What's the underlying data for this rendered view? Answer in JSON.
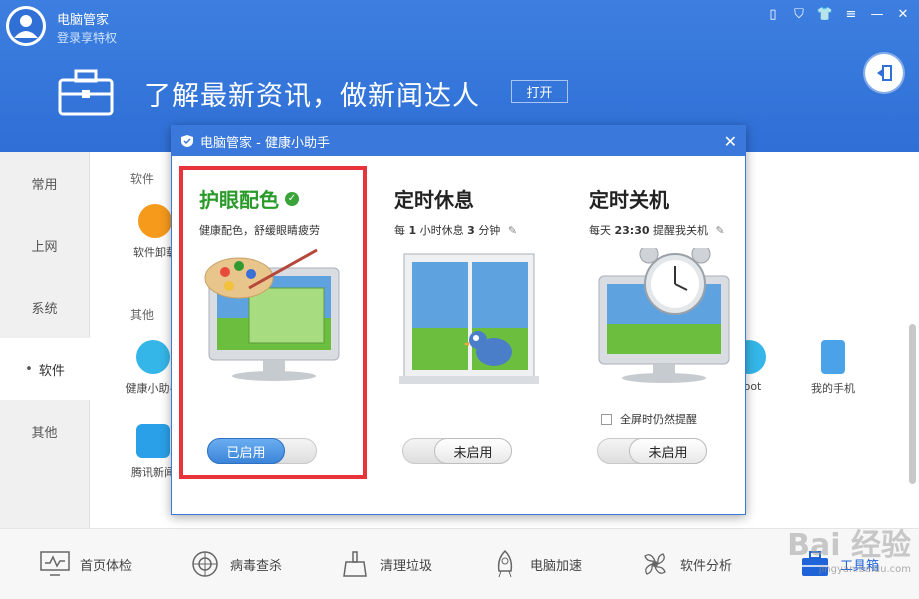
{
  "header": {
    "app_name": "电脑管家",
    "login_link": "登录享特权",
    "banner_text": "了解最新资讯，做新闻达人",
    "banner_button": "打开"
  },
  "sidebar": {
    "items": [
      {
        "label": "常用"
      },
      {
        "label": "上网"
      },
      {
        "label": "系统"
      },
      {
        "label": "软件"
      },
      {
        "label": "其他"
      }
    ],
    "active_index": 3
  },
  "content": {
    "section_software": "软件",
    "section_other": "其他",
    "tools": [
      {
        "label": "软件卸载"
      },
      {
        "label": "健康小助手"
      },
      {
        "label": "腾讯新闻"
      },
      {
        "label": "boot"
      },
      {
        "label": "我的手机"
      }
    ]
  },
  "bottom_nav": {
    "items": [
      {
        "label": "首页体检"
      },
      {
        "label": "病毒查杀"
      },
      {
        "label": "清理垃圾"
      },
      {
        "label": "电脑加速"
      },
      {
        "label": "软件分析"
      },
      {
        "label": "工具箱"
      }
    ],
    "active_index": 5
  },
  "dialog": {
    "title": "电脑管家 - 健康小助手",
    "panels": [
      {
        "title": "护眼配色",
        "desc": "健康配色，舒缓眼睛疲劳",
        "toggle_label": "已启用",
        "enabled": true
      },
      {
        "title": "定时休息",
        "desc_prefix": "每",
        "desc_hours": "1",
        "desc_mid": "小时休息",
        "desc_minutes": "3",
        "desc_suffix": "分钟",
        "toggle_label": "未启用",
        "enabled": false
      },
      {
        "title": "定时关机",
        "desc_prefix": "每天",
        "desc_time": "23:30",
        "desc_suffix": "提醒我关机",
        "fullscreen_remind": "全屏时仍然提醒",
        "toggle_label": "未启用",
        "enabled": false
      }
    ]
  },
  "watermark": {
    "text": "Bai 经验",
    "sub": "jingyan.baidu.com"
  },
  "colors": {
    "header_blue": "#3a78db",
    "highlight_red": "#e8333b",
    "enabled_green": "#2a9a2a"
  }
}
